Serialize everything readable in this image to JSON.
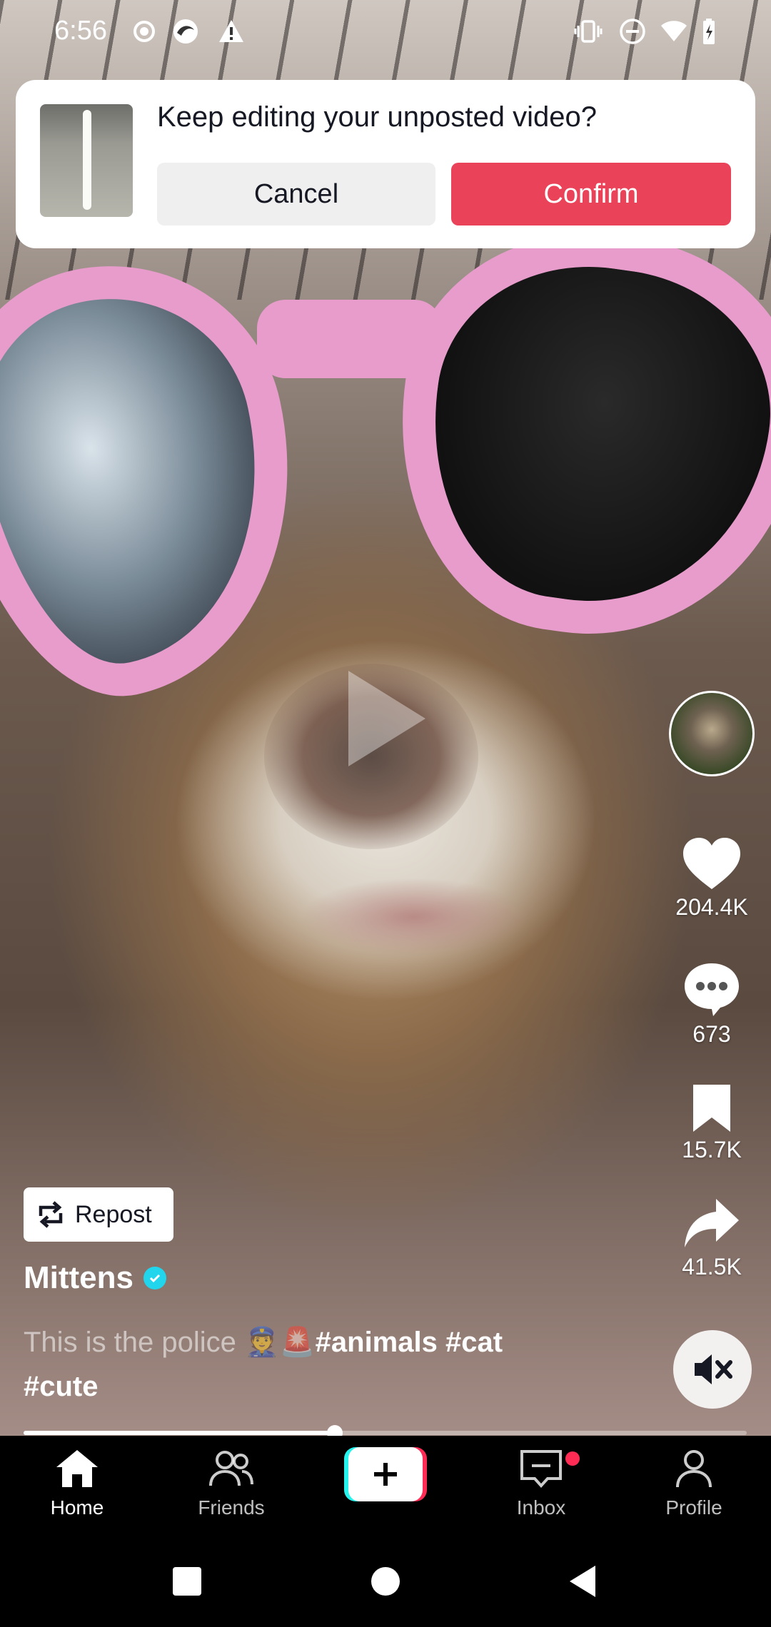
{
  "status_bar": {
    "time": "6:56",
    "left_icons": [
      "record-icon",
      "app-icon",
      "warning-icon"
    ],
    "right_icons": [
      "vibrate-icon",
      "do-not-disturb-icon",
      "wifi-icon",
      "battery-charging-icon"
    ]
  },
  "dialog": {
    "title": "Keep editing your unposted video?",
    "cancel_label": "Cancel",
    "confirm_label": "Confirm",
    "confirm_color": "#ea4359"
  },
  "video": {
    "play_icon": "play-icon",
    "progress_fraction": 0.43
  },
  "right_rail": {
    "likes": "204.4K",
    "comments": "673",
    "saves": "15.7K",
    "shares": "41.5K"
  },
  "repost": {
    "label": "Repost"
  },
  "post": {
    "username": "Mittens",
    "caption_text": "This is the police 👮🚨",
    "hashtags_line1": "#animals #cat",
    "hashtags_line2": "#cute"
  },
  "bottom_nav": {
    "items": [
      {
        "label": "Home",
        "icon": "home-icon",
        "active": true
      },
      {
        "label": "Friends",
        "icon": "friends-icon",
        "active": false
      },
      {
        "label": "",
        "icon": "create-plus-icon",
        "active": false
      },
      {
        "label": "Inbox",
        "icon": "inbox-icon",
        "active": false
      },
      {
        "label": "Profile",
        "icon": "profile-icon",
        "active": false
      }
    ]
  },
  "system_nav": [
    "recents-button",
    "home-button",
    "back-button"
  ]
}
